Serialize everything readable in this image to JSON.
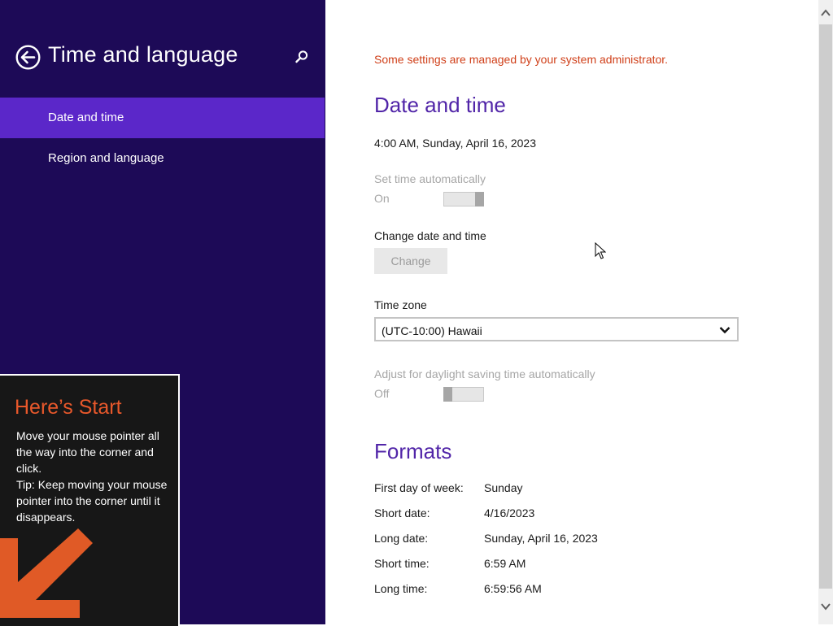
{
  "sidebar": {
    "title": "Time and language",
    "items": [
      {
        "label": "Date and time",
        "selected": true
      },
      {
        "label": "Region and language",
        "selected": false
      }
    ]
  },
  "start_tip": {
    "title": "Here’s Start",
    "body_line1": "Move your mouse pointer all the way into the corner and click.",
    "body_line2": "Tip: Keep moving your mouse pointer into the corner until it disappears."
  },
  "main": {
    "admin_notice": "Some settings are managed by your system administrator.",
    "date_time": {
      "heading": "Date and time",
      "current": "4:00 AM, Sunday, April 16, 2023",
      "set_auto_label": "Set time automatically",
      "set_auto_state": "On",
      "change_label": "Change date and time",
      "change_button": "Change",
      "timezone_label": "Time zone",
      "timezone_value": "(UTC-10:00) Hawaii",
      "dst_label": "Adjust for daylight saving time automatically",
      "dst_state": "Off"
    },
    "formats": {
      "heading": "Formats",
      "rows": [
        {
          "label": "First day of week:",
          "value": "Sunday"
        },
        {
          "label": "Short date:",
          "value": "4/16/2023"
        },
        {
          "label": "Long date:",
          "value": "Sunday, April 16, 2023"
        },
        {
          "label": "Short time:",
          "value": "6:59 AM"
        },
        {
          "label": "Long time:",
          "value": "6:59:56 AM"
        }
      ]
    }
  },
  "colors": {
    "sidebar_bg": "#1d0a57",
    "selected_bg": "#5b27c9",
    "heading": "#5125a8",
    "notice": "#d0401a",
    "tip_title": "#e8582b"
  },
  "icons": [
    "back-arrow-icon",
    "search-icon",
    "chevron-down-icon",
    "corner-arrow-icon",
    "mouse-cursor-icon"
  ]
}
